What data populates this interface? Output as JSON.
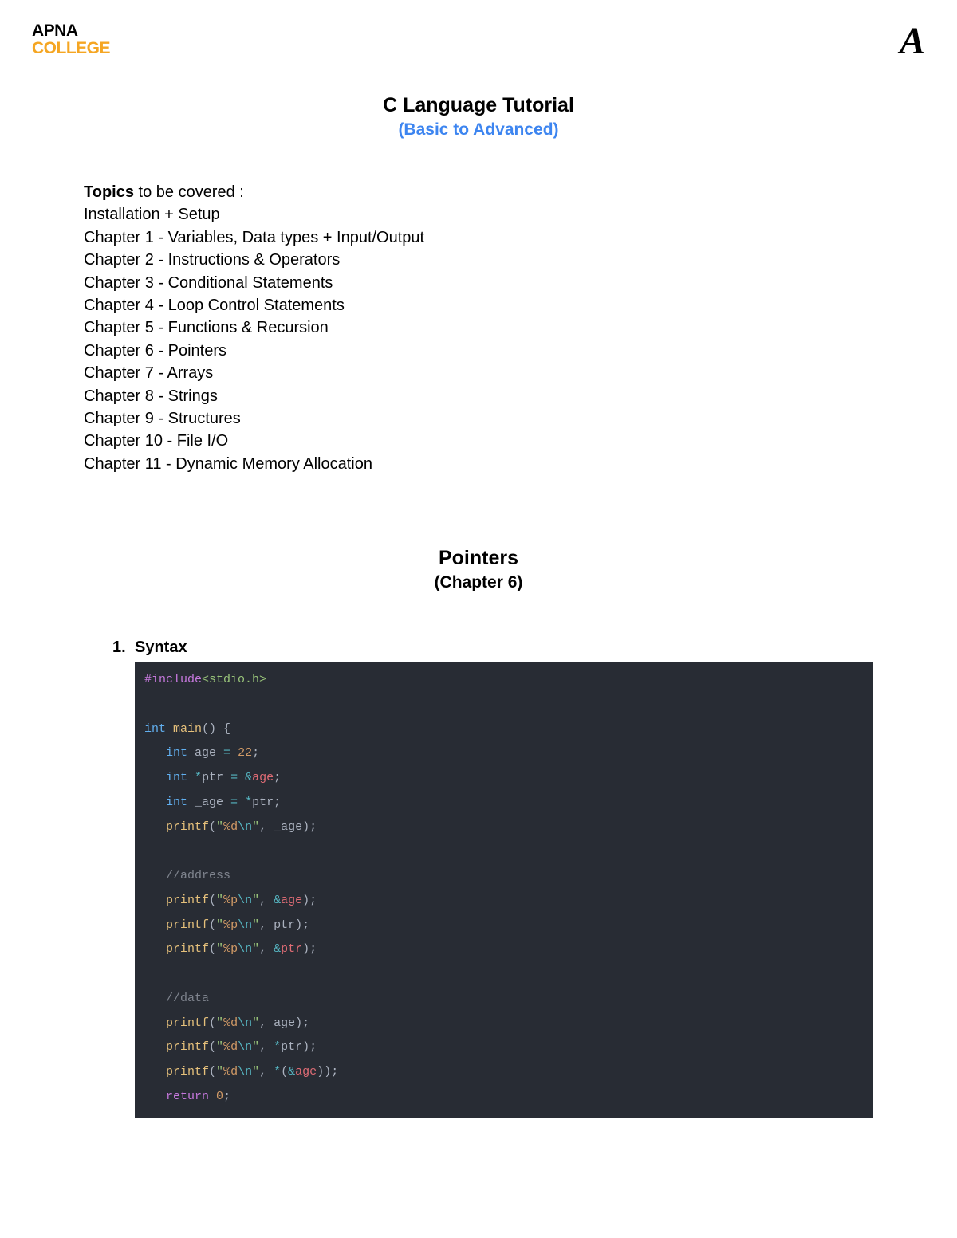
{
  "header": {
    "logo_line1": "APNA",
    "logo_line2": "COLLEGE",
    "logo_right": "A"
  },
  "title": {
    "main": "C Language Tutorial",
    "sub": "(Basic to Advanced)"
  },
  "topics": {
    "label": "Topics",
    "label_suffix": " to be covered :",
    "items": [
      "Installation + Setup",
      "Chapter 1 - Variables, Data types + Input/Output",
      "Chapter 2 - Instructions & Operators",
      "Chapter 3 - Conditional Statements",
      "Chapter 4 - Loop Control Statements",
      "Chapter 5 - Functions & Recursion",
      "Chapter 6 - Pointers",
      "Chapter 7 - Arrays",
      "Chapter 8 - Strings",
      "Chapter 9 - Structures",
      "Chapter 10 - File I/O",
      "Chapter 11 - Dynamic Memory Allocation"
    ]
  },
  "chapter": {
    "title": "Pointers",
    "sub": "(Chapter 6)"
  },
  "section": {
    "number": "1.",
    "heading": "Syntax"
  },
  "code": {
    "tokens": [
      [
        {
          "t": "#include",
          "c": "c-preproc"
        },
        {
          "t": "<stdio.h>",
          "c": "c-header"
        }
      ],
      [],
      [
        {
          "t": "int",
          "c": "c-type"
        },
        {
          "t": " ",
          "c": "c-text"
        },
        {
          "t": "main",
          "c": "c-func"
        },
        {
          "t": "() {",
          "c": "c-punct"
        }
      ],
      [
        {
          "t": "   ",
          "c": "c-text"
        },
        {
          "t": "int",
          "c": "c-type"
        },
        {
          "t": " age ",
          "c": "c-text"
        },
        {
          "t": "=",
          "c": "c-op"
        },
        {
          "t": " ",
          "c": "c-text"
        },
        {
          "t": "22",
          "c": "c-num"
        },
        {
          "t": ";",
          "c": "c-punct"
        }
      ],
      [
        {
          "t": "   ",
          "c": "c-text"
        },
        {
          "t": "int",
          "c": "c-type"
        },
        {
          "t": " ",
          "c": "c-text"
        },
        {
          "t": "*",
          "c": "c-op"
        },
        {
          "t": "ptr ",
          "c": "c-text"
        },
        {
          "t": "=",
          "c": "c-op"
        },
        {
          "t": " ",
          "c": "c-text"
        },
        {
          "t": "&",
          "c": "c-op"
        },
        {
          "t": "age",
          "c": "c-var"
        },
        {
          "t": ";",
          "c": "c-punct"
        }
      ],
      [
        {
          "t": "   ",
          "c": "c-text"
        },
        {
          "t": "int",
          "c": "c-type"
        },
        {
          "t": " _age ",
          "c": "c-text"
        },
        {
          "t": "=",
          "c": "c-op"
        },
        {
          "t": " ",
          "c": "c-text"
        },
        {
          "t": "*",
          "c": "c-op"
        },
        {
          "t": "ptr",
          "c": "c-text"
        },
        {
          "t": ";",
          "c": "c-punct"
        }
      ],
      [
        {
          "t": "   ",
          "c": "c-text"
        },
        {
          "t": "printf",
          "c": "c-func"
        },
        {
          "t": "(",
          "c": "c-punct"
        },
        {
          "t": "\"",
          "c": "c-string"
        },
        {
          "t": "%d",
          "c": "c-fmt"
        },
        {
          "t": "\\n",
          "c": "c-escape"
        },
        {
          "t": "\"",
          "c": "c-string"
        },
        {
          "t": ", _age);",
          "c": "c-punct"
        }
      ],
      [],
      [
        {
          "t": "   ",
          "c": "c-text"
        },
        {
          "t": "//address",
          "c": "c-comment"
        }
      ],
      [
        {
          "t": "   ",
          "c": "c-text"
        },
        {
          "t": "printf",
          "c": "c-func"
        },
        {
          "t": "(",
          "c": "c-punct"
        },
        {
          "t": "\"",
          "c": "c-string"
        },
        {
          "t": "%p",
          "c": "c-fmt"
        },
        {
          "t": "\\n",
          "c": "c-escape"
        },
        {
          "t": "\"",
          "c": "c-string"
        },
        {
          "t": ", ",
          "c": "c-punct"
        },
        {
          "t": "&",
          "c": "c-op"
        },
        {
          "t": "age",
          "c": "c-var"
        },
        {
          "t": ");",
          "c": "c-punct"
        }
      ],
      [
        {
          "t": "   ",
          "c": "c-text"
        },
        {
          "t": "printf",
          "c": "c-func"
        },
        {
          "t": "(",
          "c": "c-punct"
        },
        {
          "t": "\"",
          "c": "c-string"
        },
        {
          "t": "%p",
          "c": "c-fmt"
        },
        {
          "t": "\\n",
          "c": "c-escape"
        },
        {
          "t": "\"",
          "c": "c-string"
        },
        {
          "t": ", ptr);",
          "c": "c-punct"
        }
      ],
      [
        {
          "t": "   ",
          "c": "c-text"
        },
        {
          "t": "printf",
          "c": "c-func"
        },
        {
          "t": "(",
          "c": "c-punct"
        },
        {
          "t": "\"",
          "c": "c-string"
        },
        {
          "t": "%p",
          "c": "c-fmt"
        },
        {
          "t": "\\n",
          "c": "c-escape"
        },
        {
          "t": "\"",
          "c": "c-string"
        },
        {
          "t": ", ",
          "c": "c-punct"
        },
        {
          "t": "&",
          "c": "c-op"
        },
        {
          "t": "ptr",
          "c": "c-var"
        },
        {
          "t": ");",
          "c": "c-punct"
        }
      ],
      [],
      [
        {
          "t": "   ",
          "c": "c-text"
        },
        {
          "t": "//data",
          "c": "c-comment"
        }
      ],
      [
        {
          "t": "   ",
          "c": "c-text"
        },
        {
          "t": "printf",
          "c": "c-func"
        },
        {
          "t": "(",
          "c": "c-punct"
        },
        {
          "t": "\"",
          "c": "c-string"
        },
        {
          "t": "%d",
          "c": "c-fmt"
        },
        {
          "t": "\\n",
          "c": "c-escape"
        },
        {
          "t": "\"",
          "c": "c-string"
        },
        {
          "t": ", age);",
          "c": "c-punct"
        }
      ],
      [
        {
          "t": "   ",
          "c": "c-text"
        },
        {
          "t": "printf",
          "c": "c-func"
        },
        {
          "t": "(",
          "c": "c-punct"
        },
        {
          "t": "\"",
          "c": "c-string"
        },
        {
          "t": "%d",
          "c": "c-fmt"
        },
        {
          "t": "\\n",
          "c": "c-escape"
        },
        {
          "t": "\"",
          "c": "c-string"
        },
        {
          "t": ", ",
          "c": "c-punct"
        },
        {
          "t": "*",
          "c": "c-op"
        },
        {
          "t": "ptr);",
          "c": "c-punct"
        }
      ],
      [
        {
          "t": "   ",
          "c": "c-text"
        },
        {
          "t": "printf",
          "c": "c-func"
        },
        {
          "t": "(",
          "c": "c-punct"
        },
        {
          "t": "\"",
          "c": "c-string"
        },
        {
          "t": "%d",
          "c": "c-fmt"
        },
        {
          "t": "\\n",
          "c": "c-escape"
        },
        {
          "t": "\"",
          "c": "c-string"
        },
        {
          "t": ", ",
          "c": "c-punct"
        },
        {
          "t": "*",
          "c": "c-op"
        },
        {
          "t": "(",
          "c": "c-punct"
        },
        {
          "t": "&",
          "c": "c-op"
        },
        {
          "t": "age",
          "c": "c-var"
        },
        {
          "t": "));",
          "c": "c-punct"
        }
      ],
      [
        {
          "t": "   ",
          "c": "c-text"
        },
        {
          "t": "return",
          "c": "c-return"
        },
        {
          "t": " ",
          "c": "c-text"
        },
        {
          "t": "0",
          "c": "c-num"
        },
        {
          "t": ";",
          "c": "c-punct"
        }
      ]
    ]
  }
}
